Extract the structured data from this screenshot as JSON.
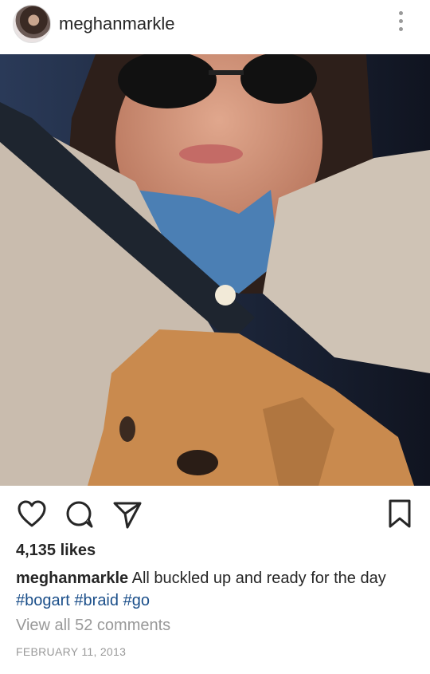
{
  "post": {
    "username": "meghanmarkle",
    "likes": "4,135 likes",
    "caption_text": "All buckled up and ready for the day",
    "hashtags": [
      "#bogart",
      "#braid",
      "#go"
    ],
    "view_comments": "View all 52 comments",
    "date": "FEBRUARY 11, 2013"
  },
  "icons": {
    "more": "more-vertical-icon",
    "like": "heart-icon",
    "comment": "comment-icon",
    "share": "send-icon",
    "save": "bookmark-icon"
  },
  "colors": {
    "text": "#262626",
    "muted": "#999999",
    "hashtag": "#1b4f8a"
  }
}
